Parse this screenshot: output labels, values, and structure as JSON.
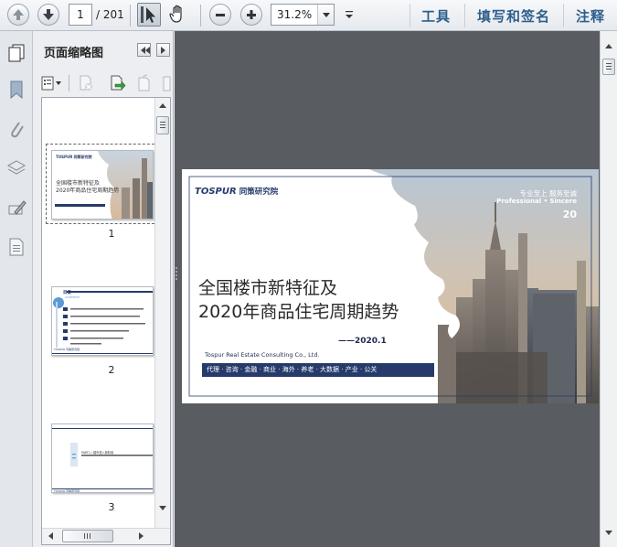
{
  "toolbar": {
    "page_current": "1",
    "page_total": "/ 201",
    "zoom_value": "31.2%",
    "links": [
      "工具",
      "填写和签名",
      "注释"
    ]
  },
  "panel": {
    "title": "页面缩略图"
  },
  "thumbnails": [
    {
      "number": "1",
      "title_line1": "全国楼市新特征及",
      "title_line2": "2020年商品住宅周期趋势",
      "header": "TOSPUR 同策研究院"
    },
    {
      "number": "2",
      "heading": "目录",
      "subheading": "CONTENTS",
      "header": "TOSPUR 同策研究院"
    },
    {
      "number": "3",
      "text": "PART1 / 楼市进入新阶段",
      "header": "TOSPUR 同策研究院"
    }
  ],
  "slide": {
    "logo": "TOSPUR",
    "logo_cn": "同策研究院",
    "slogan_cn": "专业至上 服务至诚",
    "slogan_en": "Professional • Sincere",
    "badge": "20",
    "title_line1": "全国楼市新特征及",
    "title_line2": "2020年商品住宅周期趋势",
    "date": "——2020.1",
    "company": "Tospur Real Estate Consulting Co., Ltd.",
    "services": "代理 · 咨询 · 金融 · 商业 · 海外 · 养老 · 大数据 · 产业 · 公关"
  },
  "colors": {
    "toolbar_link": "#2e5f8c",
    "doc_background": "#595c60",
    "slide_navy": "#263b6b"
  }
}
